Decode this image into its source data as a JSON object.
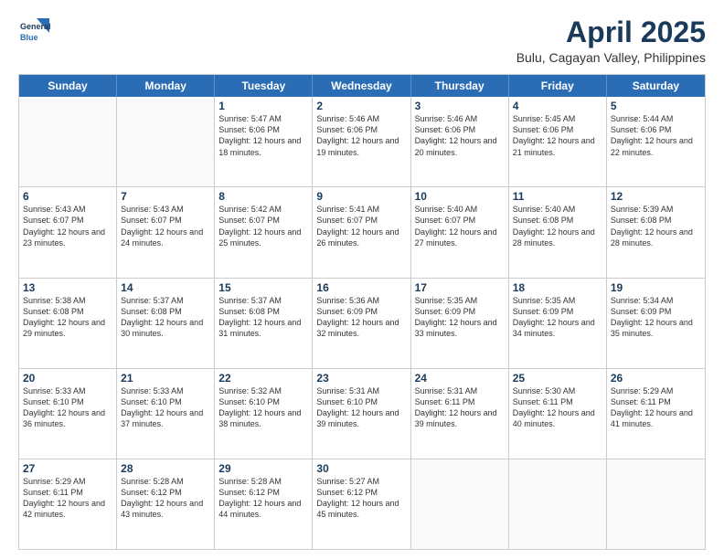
{
  "logo": {
    "line1": "General",
    "line2": "Blue"
  },
  "title": "April 2025",
  "subtitle": "Bulu, Cagayan Valley, Philippines",
  "header_days": [
    "Sunday",
    "Monday",
    "Tuesday",
    "Wednesday",
    "Thursday",
    "Friday",
    "Saturday"
  ],
  "weeks": [
    [
      {
        "day": "",
        "sunrise": "",
        "sunset": "",
        "daylight": ""
      },
      {
        "day": "",
        "sunrise": "",
        "sunset": "",
        "daylight": ""
      },
      {
        "day": "1",
        "sunrise": "Sunrise: 5:47 AM",
        "sunset": "Sunset: 6:06 PM",
        "daylight": "Daylight: 12 hours and 18 minutes."
      },
      {
        "day": "2",
        "sunrise": "Sunrise: 5:46 AM",
        "sunset": "Sunset: 6:06 PM",
        "daylight": "Daylight: 12 hours and 19 minutes."
      },
      {
        "day": "3",
        "sunrise": "Sunrise: 5:46 AM",
        "sunset": "Sunset: 6:06 PM",
        "daylight": "Daylight: 12 hours and 20 minutes."
      },
      {
        "day": "4",
        "sunrise": "Sunrise: 5:45 AM",
        "sunset": "Sunset: 6:06 PM",
        "daylight": "Daylight: 12 hours and 21 minutes."
      },
      {
        "day": "5",
        "sunrise": "Sunrise: 5:44 AM",
        "sunset": "Sunset: 6:06 PM",
        "daylight": "Daylight: 12 hours and 22 minutes."
      }
    ],
    [
      {
        "day": "6",
        "sunrise": "Sunrise: 5:43 AM",
        "sunset": "Sunset: 6:07 PM",
        "daylight": "Daylight: 12 hours and 23 minutes."
      },
      {
        "day": "7",
        "sunrise": "Sunrise: 5:43 AM",
        "sunset": "Sunset: 6:07 PM",
        "daylight": "Daylight: 12 hours and 24 minutes."
      },
      {
        "day": "8",
        "sunrise": "Sunrise: 5:42 AM",
        "sunset": "Sunset: 6:07 PM",
        "daylight": "Daylight: 12 hours and 25 minutes."
      },
      {
        "day": "9",
        "sunrise": "Sunrise: 5:41 AM",
        "sunset": "Sunset: 6:07 PM",
        "daylight": "Daylight: 12 hours and 26 minutes."
      },
      {
        "day": "10",
        "sunrise": "Sunrise: 5:40 AM",
        "sunset": "Sunset: 6:07 PM",
        "daylight": "Daylight: 12 hours and 27 minutes."
      },
      {
        "day": "11",
        "sunrise": "Sunrise: 5:40 AM",
        "sunset": "Sunset: 6:08 PM",
        "daylight": "Daylight: 12 hours and 28 minutes."
      },
      {
        "day": "12",
        "sunrise": "Sunrise: 5:39 AM",
        "sunset": "Sunset: 6:08 PM",
        "daylight": "Daylight: 12 hours and 28 minutes."
      }
    ],
    [
      {
        "day": "13",
        "sunrise": "Sunrise: 5:38 AM",
        "sunset": "Sunset: 6:08 PM",
        "daylight": "Daylight: 12 hours and 29 minutes."
      },
      {
        "day": "14",
        "sunrise": "Sunrise: 5:37 AM",
        "sunset": "Sunset: 6:08 PM",
        "daylight": "Daylight: 12 hours and 30 minutes."
      },
      {
        "day": "15",
        "sunrise": "Sunrise: 5:37 AM",
        "sunset": "Sunset: 6:08 PM",
        "daylight": "Daylight: 12 hours and 31 minutes."
      },
      {
        "day": "16",
        "sunrise": "Sunrise: 5:36 AM",
        "sunset": "Sunset: 6:09 PM",
        "daylight": "Daylight: 12 hours and 32 minutes."
      },
      {
        "day": "17",
        "sunrise": "Sunrise: 5:35 AM",
        "sunset": "Sunset: 6:09 PM",
        "daylight": "Daylight: 12 hours and 33 minutes."
      },
      {
        "day": "18",
        "sunrise": "Sunrise: 5:35 AM",
        "sunset": "Sunset: 6:09 PM",
        "daylight": "Daylight: 12 hours and 34 minutes."
      },
      {
        "day": "19",
        "sunrise": "Sunrise: 5:34 AM",
        "sunset": "Sunset: 6:09 PM",
        "daylight": "Daylight: 12 hours and 35 minutes."
      }
    ],
    [
      {
        "day": "20",
        "sunrise": "Sunrise: 5:33 AM",
        "sunset": "Sunset: 6:10 PM",
        "daylight": "Daylight: 12 hours and 36 minutes."
      },
      {
        "day": "21",
        "sunrise": "Sunrise: 5:33 AM",
        "sunset": "Sunset: 6:10 PM",
        "daylight": "Daylight: 12 hours and 37 minutes."
      },
      {
        "day": "22",
        "sunrise": "Sunrise: 5:32 AM",
        "sunset": "Sunset: 6:10 PM",
        "daylight": "Daylight: 12 hours and 38 minutes."
      },
      {
        "day": "23",
        "sunrise": "Sunrise: 5:31 AM",
        "sunset": "Sunset: 6:10 PM",
        "daylight": "Daylight: 12 hours and 39 minutes."
      },
      {
        "day": "24",
        "sunrise": "Sunrise: 5:31 AM",
        "sunset": "Sunset: 6:11 PM",
        "daylight": "Daylight: 12 hours and 39 minutes."
      },
      {
        "day": "25",
        "sunrise": "Sunrise: 5:30 AM",
        "sunset": "Sunset: 6:11 PM",
        "daylight": "Daylight: 12 hours and 40 minutes."
      },
      {
        "day": "26",
        "sunrise": "Sunrise: 5:29 AM",
        "sunset": "Sunset: 6:11 PM",
        "daylight": "Daylight: 12 hours and 41 minutes."
      }
    ],
    [
      {
        "day": "27",
        "sunrise": "Sunrise: 5:29 AM",
        "sunset": "Sunset: 6:11 PM",
        "daylight": "Daylight: 12 hours and 42 minutes."
      },
      {
        "day": "28",
        "sunrise": "Sunrise: 5:28 AM",
        "sunset": "Sunset: 6:12 PM",
        "daylight": "Daylight: 12 hours and 43 minutes."
      },
      {
        "day": "29",
        "sunrise": "Sunrise: 5:28 AM",
        "sunset": "Sunset: 6:12 PM",
        "daylight": "Daylight: 12 hours and 44 minutes."
      },
      {
        "day": "30",
        "sunrise": "Sunrise: 5:27 AM",
        "sunset": "Sunset: 6:12 PM",
        "daylight": "Daylight: 12 hours and 45 minutes."
      },
      {
        "day": "",
        "sunrise": "",
        "sunset": "",
        "daylight": ""
      },
      {
        "day": "",
        "sunrise": "",
        "sunset": "",
        "daylight": ""
      },
      {
        "day": "",
        "sunrise": "",
        "sunset": "",
        "daylight": ""
      }
    ]
  ]
}
